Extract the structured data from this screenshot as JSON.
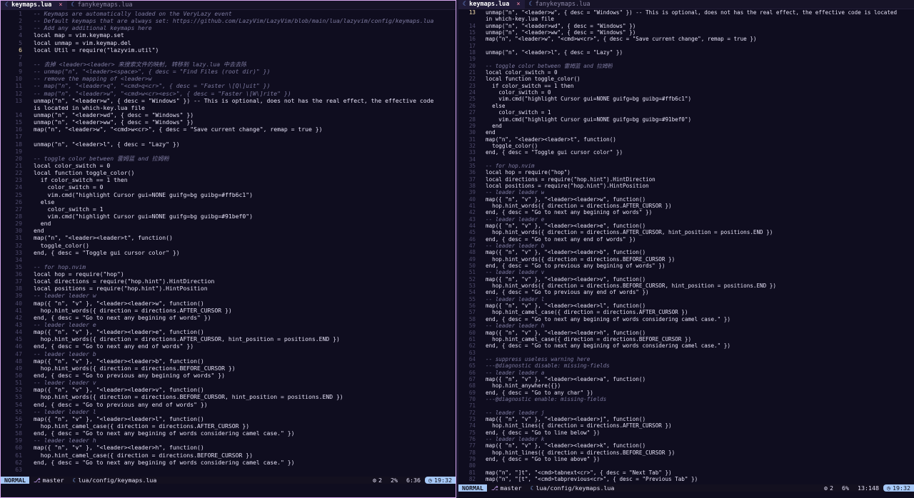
{
  "left_pane": {
    "tabs": [
      {
        "label": "keymaps.lua",
        "active": true,
        "close": "×"
      },
      {
        "label": "fanykeymaps.lua",
        "active": false
      }
    ],
    "current_line": 6,
    "lines": [
      {
        "n": "1",
        "t": "-- Keymaps are automatically loaded on the VeryLazy event",
        "c": true
      },
      {
        "n": "2",
        "t": "-- Default keymaps that are always set: https://github.com/LazyVim/LazyVim/blob/main/lua/lazyvim/config/keymaps.lua",
        "c": true
      },
      {
        "n": "3",
        "t": "-- Add any additional keymaps here",
        "c": true
      },
      {
        "n": "4",
        "t": "local map = vim.keymap.set"
      },
      {
        "n": "5",
        "t": "local unmap = vim.keymap.del"
      },
      {
        "n": "6",
        "t": "local Util = require(\"lazyvim.util\")"
      },
      {
        "n": "7",
        "t": ""
      },
      {
        "n": "8",
        "t": "-- 去掉 <leader><leader> 来搜索文件的映射, 转移到 lazy.lua 中去去除",
        "c": true
      },
      {
        "n": "9",
        "t": "-- unmap(\"n\", \"<leader><space>\", { desc = \"Find Files (root dir)\" })",
        "c": true
      },
      {
        "n": "10",
        "t": "-- remove the mapping of <leader>w",
        "c": true
      },
      {
        "n": "11",
        "t": "-- map(\"n\", \"<leader>q\", \"<cmd>q<cr>\", { desc = \"Faster \\[Q\\]uit\" })",
        "c": true
      },
      {
        "n": "12",
        "t": "-- map(\"n\", \"<leader>w\", \"<cmd>w<cr><esc>\", { desc = \"Faster \\[W\\]rite\" })",
        "c": true
      },
      {
        "n": "13",
        "t": "unmap(\"n\", \"<leader>w\", { desc = \"Windows\" }) -- This is optional, does not has the real effect, the effective code"
      },
      {
        "n": "",
        "t": "is located in which-key.lua file"
      },
      {
        "n": "14",
        "t": "unmap(\"n\", \"<leader>wd\", { desc = \"Windows\" })"
      },
      {
        "n": "15",
        "t": "unmap(\"n\", \"<leader>ww\", { desc = \"Windows\" })"
      },
      {
        "n": "16",
        "t": "map(\"n\", \"<leader>w\", \"<cmd>w<cr>\", { desc = \"Save current change\", remap = true })"
      },
      {
        "n": "17",
        "t": ""
      },
      {
        "n": "18",
        "t": "unmap(\"n\", \"<leader>l\", { desc = \"Lazy\" })"
      },
      {
        "n": "19",
        "t": ""
      },
      {
        "n": "20",
        "t": "-- toggle color between 雷姆蓝 and 拉姆粉",
        "c": true
      },
      {
        "n": "21",
        "t": "local color_switch = 0"
      },
      {
        "n": "22",
        "t": "local function toggle_color()"
      },
      {
        "n": "23",
        "t": "  if color_switch == 1 then"
      },
      {
        "n": "24",
        "t": "    color_switch = 0"
      },
      {
        "n": "25",
        "t": "    vim.cmd(\"highlight Cursor gui=NONE guifg=bg guibg=#ffb6c1\")"
      },
      {
        "n": "26",
        "t": "  else"
      },
      {
        "n": "27",
        "t": "    color_switch = 1"
      },
      {
        "n": "28",
        "t": "    vim.cmd(\"highlight Cursor gui=NONE guifg=bg guibg=#91bef0\")"
      },
      {
        "n": "29",
        "t": "  end"
      },
      {
        "n": "30",
        "t": "end"
      },
      {
        "n": "31",
        "t": "map(\"n\", \"<leader><leader>t\", function()"
      },
      {
        "n": "32",
        "t": "  toggle_color()"
      },
      {
        "n": "33",
        "t": "end, { desc = \"Toggle gui cursor color\" })"
      },
      {
        "n": "34",
        "t": ""
      },
      {
        "n": "35",
        "t": "-- for hop.nvim",
        "c": true
      },
      {
        "n": "36",
        "t": "local hop = require(\"hop\")"
      },
      {
        "n": "37",
        "t": "local directions = require(\"hop.hint\").HintDirection"
      },
      {
        "n": "38",
        "t": "local positions = require(\"hop.hint\").HintPosition"
      },
      {
        "n": "39",
        "t": "-- leader leader w",
        "c": true
      },
      {
        "n": "40",
        "t": "map({ \"n\", \"v\" }, \"<leader><leader>w\", function()"
      },
      {
        "n": "41",
        "t": "  hop.hint_words({ direction = directions.AFTER_CURSOR })"
      },
      {
        "n": "42",
        "t": "end, { desc = \"Go to next any begining of words\" })"
      },
      {
        "n": "43",
        "t": "-- leader leader e",
        "c": true
      },
      {
        "n": "44",
        "t": "map({ \"n\", \"v\" }, \"<leader><leader>e\", function()"
      },
      {
        "n": "45",
        "t": "  hop.hint_words({ direction = directions.AFTER_CURSOR, hint_position = positions.END })"
      },
      {
        "n": "46",
        "t": "end, { desc = \"Go to next any end of words\" })"
      },
      {
        "n": "47",
        "t": "-- leader leader b",
        "c": true
      },
      {
        "n": "48",
        "t": "map({ \"n\", \"v\" }, \"<leader><leader>b\", function()"
      },
      {
        "n": "49",
        "t": "  hop.hint_words({ direction = directions.BEFORE_CURSOR })"
      },
      {
        "n": "50",
        "t": "end, { desc = \"Go to previous any begining of words\" })"
      },
      {
        "n": "51",
        "t": "-- leader leader v",
        "c": true
      },
      {
        "n": "52",
        "t": "map({ \"n\", \"v\" }, \"<leader><leader>v\", function()"
      },
      {
        "n": "53",
        "t": "  hop.hint_words({ direction = directions.BEFORE_CURSOR, hint_position = positions.END })"
      },
      {
        "n": "54",
        "t": "end, { desc = \"Go to previous any end of words\" })"
      },
      {
        "n": "55",
        "t": "-- leader leader l",
        "c": true
      },
      {
        "n": "56",
        "t": "map({ \"n\", \"v\" }, \"<leader><leader>l\", function()"
      },
      {
        "n": "57",
        "t": "  hop.hint_camel_case({ direction = directions.AFTER_CURSOR })"
      },
      {
        "n": "58",
        "t": "end, { desc = \"Go to next any begining of words considering camel case.\" })"
      },
      {
        "n": "59",
        "t": "-- leader leader h",
        "c": true
      },
      {
        "n": "60",
        "t": "map({ \"n\", \"v\" }, \"<leader><leader>h\", function()"
      },
      {
        "n": "61",
        "t": "  hop.hint_camel_case({ direction = directions.BEFORE_CURSOR })"
      },
      {
        "n": "62",
        "t": "end, { desc = \"Go to next any begining of words considering camel case.\" })"
      },
      {
        "n": "63",
        "t": ""
      }
    ],
    "status": {
      "mode": "NORMAL",
      "branch": "master",
      "file": "lua/config/keymaps.lua",
      "diagnostics": "2",
      "percent": "2%",
      "position": "6:36",
      "clock": "19:32"
    }
  },
  "right_pane": {
    "tabs": [
      {
        "label": "keymaps.lua",
        "active": true,
        "close": "×"
      },
      {
        "label": "fanykeymaps.lua",
        "active": false
      }
    ],
    "current_line": 13,
    "lines": [
      {
        "n": "13",
        "t": "unmap(\"n\", \"<leader>w\", { desc = \"Windows\" }) -- This is optional, does not has the real effect, the effective code is located"
      },
      {
        "n": "",
        "t": "in which-key.lua file"
      },
      {
        "n": "14",
        "t": "unmap(\"n\", \"<leader>wd\", { desc = \"Windows\" })"
      },
      {
        "n": "15",
        "t": "unmap(\"n\", \"<leader>ww\", { desc = \"Windows\" })"
      },
      {
        "n": "16",
        "t": "map(\"n\", \"<leader>w\", \"<cmd>w<cr>\", { desc = \"Save current change\", remap = true })"
      },
      {
        "n": "17",
        "t": ""
      },
      {
        "n": "18",
        "t": "unmap(\"n\", \"<leader>l\", { desc = \"Lazy\" })"
      },
      {
        "n": "19",
        "t": ""
      },
      {
        "n": "20",
        "t": "-- toggle color between 雷姆蓝 and 拉姆粉",
        "c": true
      },
      {
        "n": "21",
        "t": "local color_switch = 0"
      },
      {
        "n": "22",
        "t": "local function toggle_color()"
      },
      {
        "n": "23",
        "t": "  if color_switch == 1 then"
      },
      {
        "n": "24",
        "t": "    color_switch = 0"
      },
      {
        "n": "25",
        "t": "    vim.cmd(\"highlight Cursor gui=NONE guifg=bg guibg=#ffb6c1\")"
      },
      {
        "n": "26",
        "t": "  else"
      },
      {
        "n": "27",
        "t": "    color_switch = 1"
      },
      {
        "n": "28",
        "t": "    vim.cmd(\"highlight Cursor gui=NONE guifg=bg guibg=#91bef0\")"
      },
      {
        "n": "29",
        "t": "  end"
      },
      {
        "n": "30",
        "t": "end"
      },
      {
        "n": "31",
        "t": "map(\"n\", \"<leader><leader>t\", function()"
      },
      {
        "n": "32",
        "t": "  toggle_color()"
      },
      {
        "n": "33",
        "t": "end, { desc = \"Toggle gui cursor color\" })"
      },
      {
        "n": "34",
        "t": ""
      },
      {
        "n": "35",
        "t": "-- for hop.nvim",
        "c": true
      },
      {
        "n": "36",
        "t": "local hop = require(\"hop\")"
      },
      {
        "n": "37",
        "t": "local directions = require(\"hop.hint\").HintDirection"
      },
      {
        "n": "38",
        "t": "local positions = require(\"hop.hint\").HintPosition"
      },
      {
        "n": "39",
        "t": "-- leader leader w",
        "c": true
      },
      {
        "n": "40",
        "t": "map({ \"n\", \"v\" }, \"<leader><leader>w\", function()"
      },
      {
        "n": "41",
        "t": "  hop.hint_words({ direction = directions.AFTER_CURSOR })"
      },
      {
        "n": "42",
        "t": "end, { desc = \"Go to next any begining of words\" })"
      },
      {
        "n": "43",
        "t": "-- leader leader e",
        "c": true
      },
      {
        "n": "44",
        "t": "map({ \"n\", \"v\" }, \"<leader><leader>e\", function()"
      },
      {
        "n": "45",
        "t": "  hop.hint_words({ direction = directions.AFTER_CURSOR, hint_position = positions.END })"
      },
      {
        "n": "46",
        "t": "end, { desc = \"Go to next any end of words\" })"
      },
      {
        "n": "47",
        "t": "-- leader leader b",
        "c": true
      },
      {
        "n": "48",
        "t": "map({ \"n\", \"v\" }, \"<leader><leader>b\", function()"
      },
      {
        "n": "49",
        "t": "  hop.hint_words({ direction = directions.BEFORE_CURSOR })"
      },
      {
        "n": "50",
        "t": "end, { desc = \"Go to previous any begining of words\" })"
      },
      {
        "n": "51",
        "t": "-- leader leader v",
        "c": true
      },
      {
        "n": "52",
        "t": "map({ \"n\", \"v\" }, \"<leader><leader>v\", function()"
      },
      {
        "n": "53",
        "t": "  hop.hint_words({ direction = directions.BEFORE_CURSOR, hint_position = positions.END })"
      },
      {
        "n": "54",
        "t": "end, { desc = \"Go to previous any end of words\" })"
      },
      {
        "n": "55",
        "t": "-- leader leader l",
        "c": true
      },
      {
        "n": "56",
        "t": "map({ \"n\", \"v\" }, \"<leader><leader>l\", function()"
      },
      {
        "n": "57",
        "t": "  hop.hint_camel_case({ direction = directions.AFTER_CURSOR })"
      },
      {
        "n": "58",
        "t": "end, { desc = \"Go to next any begining of words considering camel case.\" })"
      },
      {
        "n": "59",
        "t": "-- leader leader h",
        "c": true
      },
      {
        "n": "60",
        "t": "map({ \"n\", \"v\" }, \"<leader><leader>h\", function()"
      },
      {
        "n": "61",
        "t": "  hop.hint_camel_case({ direction = directions.BEFORE_CURSOR })"
      },
      {
        "n": "62",
        "t": "end, { desc = \"Go to next any begining of words considering camel case.\" })"
      },
      {
        "n": "63",
        "t": ""
      },
      {
        "n": "64",
        "t": "-- suppress useless warning here",
        "c": true
      },
      {
        "n": "65",
        "t": "---@diagnostic disable: missing-fields",
        "c": true
      },
      {
        "n": "66",
        "t": "-- leader leader a",
        "c": true
      },
      {
        "n": "67",
        "t": "map({ \"n\", \"v\" }, \"<leader><leader>a\", function()"
      },
      {
        "n": "68",
        "t": "  hop.hint_anywhere({})"
      },
      {
        "n": "69",
        "t": "end, { desc = \"Go to any char\" })"
      },
      {
        "n": "70",
        "t": "---@diagnostic enable: missing-fields",
        "c": true
      },
      {
        "n": "71",
        "t": ""
      },
      {
        "n": "72",
        "t": "-- leader leader j",
        "c": true
      },
      {
        "n": "73",
        "t": "map({ \"n\", \"v\" }, \"<leader><leader>j\", function()"
      },
      {
        "n": "74",
        "t": "  hop.hint_lines({ direction = directions.AFTER_CURSOR })"
      },
      {
        "n": "75",
        "t": "end, { desc = \"Go to line below\" })"
      },
      {
        "n": "76",
        "t": "-- leader leader k",
        "c": true
      },
      {
        "n": "77",
        "t": "map({ \"n\", \"v\" }, \"<leader><leader>k\", function()"
      },
      {
        "n": "78",
        "t": "  hop.hint_lines({ direction = directions.BEFORE_CURSOR })"
      },
      {
        "n": "79",
        "t": "end, { desc = \"Go to line above\" })"
      },
      {
        "n": "80",
        "t": ""
      },
      {
        "n": "81",
        "t": "map(\"n\", \"]t\", \"<cmd>tabnext<cr>\", { desc = \"Next Tab\" })"
      },
      {
        "n": "82",
        "t": "map(\"n\", \"[t\", \"<cmd>tabprevious<cr>\", { desc = \"Previous Tab\" })"
      }
    ],
    "status": {
      "mode": "NORMAL",
      "branch": "master",
      "file": "lua/config/keymaps.lua",
      "diagnostics": "2",
      "percent": "6%",
      "position": "13:148",
      "clock": "19:32"
    }
  },
  "icons": {
    "lua": "lua-file-icon",
    "branch": "git-branch-icon",
    "diagnostics": "gear-icon",
    "clock": "clock-icon"
  },
  "colors": {
    "mode_bg": "#a6c8f7",
    "border_active": "#d7a9f0",
    "comment": "#7d7aa0"
  }
}
